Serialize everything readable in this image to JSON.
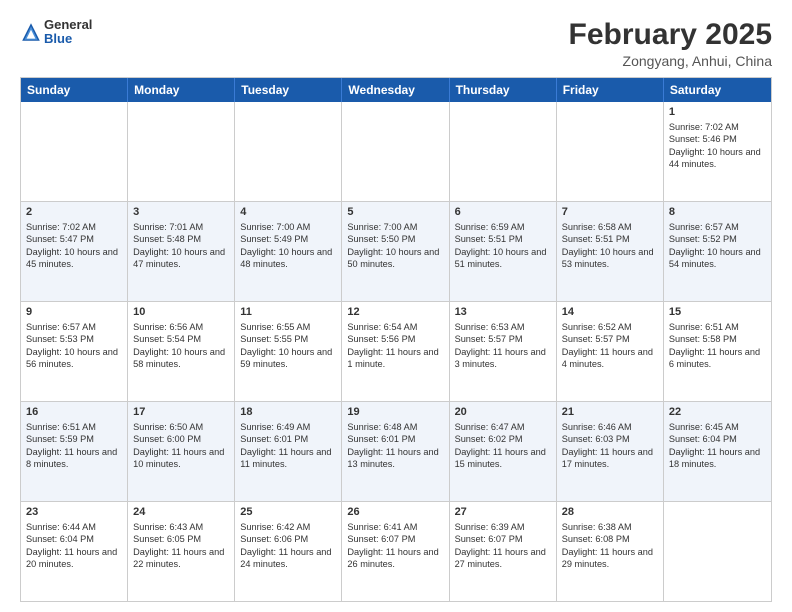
{
  "header": {
    "logo_general": "General",
    "logo_blue": "Blue",
    "month_title": "February 2025",
    "location": "Zongyang, Anhui, China"
  },
  "weekdays": [
    "Sunday",
    "Monday",
    "Tuesday",
    "Wednesday",
    "Thursday",
    "Friday",
    "Saturday"
  ],
  "rows": [
    [
      {
        "day": "",
        "text": ""
      },
      {
        "day": "",
        "text": ""
      },
      {
        "day": "",
        "text": ""
      },
      {
        "day": "",
        "text": ""
      },
      {
        "day": "",
        "text": ""
      },
      {
        "day": "",
        "text": ""
      },
      {
        "day": "1",
        "text": "Sunrise: 7:02 AM\nSunset: 5:46 PM\nDaylight: 10 hours and 44 minutes."
      }
    ],
    [
      {
        "day": "2",
        "text": "Sunrise: 7:02 AM\nSunset: 5:47 PM\nDaylight: 10 hours and 45 minutes."
      },
      {
        "day": "3",
        "text": "Sunrise: 7:01 AM\nSunset: 5:48 PM\nDaylight: 10 hours and 47 minutes."
      },
      {
        "day": "4",
        "text": "Sunrise: 7:00 AM\nSunset: 5:49 PM\nDaylight: 10 hours and 48 minutes."
      },
      {
        "day": "5",
        "text": "Sunrise: 7:00 AM\nSunset: 5:50 PM\nDaylight: 10 hours and 50 minutes."
      },
      {
        "day": "6",
        "text": "Sunrise: 6:59 AM\nSunset: 5:51 PM\nDaylight: 10 hours and 51 minutes."
      },
      {
        "day": "7",
        "text": "Sunrise: 6:58 AM\nSunset: 5:51 PM\nDaylight: 10 hours and 53 minutes."
      },
      {
        "day": "8",
        "text": "Sunrise: 6:57 AM\nSunset: 5:52 PM\nDaylight: 10 hours and 54 minutes."
      }
    ],
    [
      {
        "day": "9",
        "text": "Sunrise: 6:57 AM\nSunset: 5:53 PM\nDaylight: 10 hours and 56 minutes."
      },
      {
        "day": "10",
        "text": "Sunrise: 6:56 AM\nSunset: 5:54 PM\nDaylight: 10 hours and 58 minutes."
      },
      {
        "day": "11",
        "text": "Sunrise: 6:55 AM\nSunset: 5:55 PM\nDaylight: 10 hours and 59 minutes."
      },
      {
        "day": "12",
        "text": "Sunrise: 6:54 AM\nSunset: 5:56 PM\nDaylight: 11 hours and 1 minute."
      },
      {
        "day": "13",
        "text": "Sunrise: 6:53 AM\nSunset: 5:57 PM\nDaylight: 11 hours and 3 minutes."
      },
      {
        "day": "14",
        "text": "Sunrise: 6:52 AM\nSunset: 5:57 PM\nDaylight: 11 hours and 4 minutes."
      },
      {
        "day": "15",
        "text": "Sunrise: 6:51 AM\nSunset: 5:58 PM\nDaylight: 11 hours and 6 minutes."
      }
    ],
    [
      {
        "day": "16",
        "text": "Sunrise: 6:51 AM\nSunset: 5:59 PM\nDaylight: 11 hours and 8 minutes."
      },
      {
        "day": "17",
        "text": "Sunrise: 6:50 AM\nSunset: 6:00 PM\nDaylight: 11 hours and 10 minutes."
      },
      {
        "day": "18",
        "text": "Sunrise: 6:49 AM\nSunset: 6:01 PM\nDaylight: 11 hours and 11 minutes."
      },
      {
        "day": "19",
        "text": "Sunrise: 6:48 AM\nSunset: 6:01 PM\nDaylight: 11 hours and 13 minutes."
      },
      {
        "day": "20",
        "text": "Sunrise: 6:47 AM\nSunset: 6:02 PM\nDaylight: 11 hours and 15 minutes."
      },
      {
        "day": "21",
        "text": "Sunrise: 6:46 AM\nSunset: 6:03 PM\nDaylight: 11 hours and 17 minutes."
      },
      {
        "day": "22",
        "text": "Sunrise: 6:45 AM\nSunset: 6:04 PM\nDaylight: 11 hours and 18 minutes."
      }
    ],
    [
      {
        "day": "23",
        "text": "Sunrise: 6:44 AM\nSunset: 6:04 PM\nDaylight: 11 hours and 20 minutes."
      },
      {
        "day": "24",
        "text": "Sunrise: 6:43 AM\nSunset: 6:05 PM\nDaylight: 11 hours and 22 minutes."
      },
      {
        "day": "25",
        "text": "Sunrise: 6:42 AM\nSunset: 6:06 PM\nDaylight: 11 hours and 24 minutes."
      },
      {
        "day": "26",
        "text": "Sunrise: 6:41 AM\nSunset: 6:07 PM\nDaylight: 11 hours and 26 minutes."
      },
      {
        "day": "27",
        "text": "Sunrise: 6:39 AM\nSunset: 6:07 PM\nDaylight: 11 hours and 27 minutes."
      },
      {
        "day": "28",
        "text": "Sunrise: 6:38 AM\nSunset: 6:08 PM\nDaylight: 11 hours and 29 minutes."
      },
      {
        "day": "",
        "text": ""
      }
    ]
  ]
}
